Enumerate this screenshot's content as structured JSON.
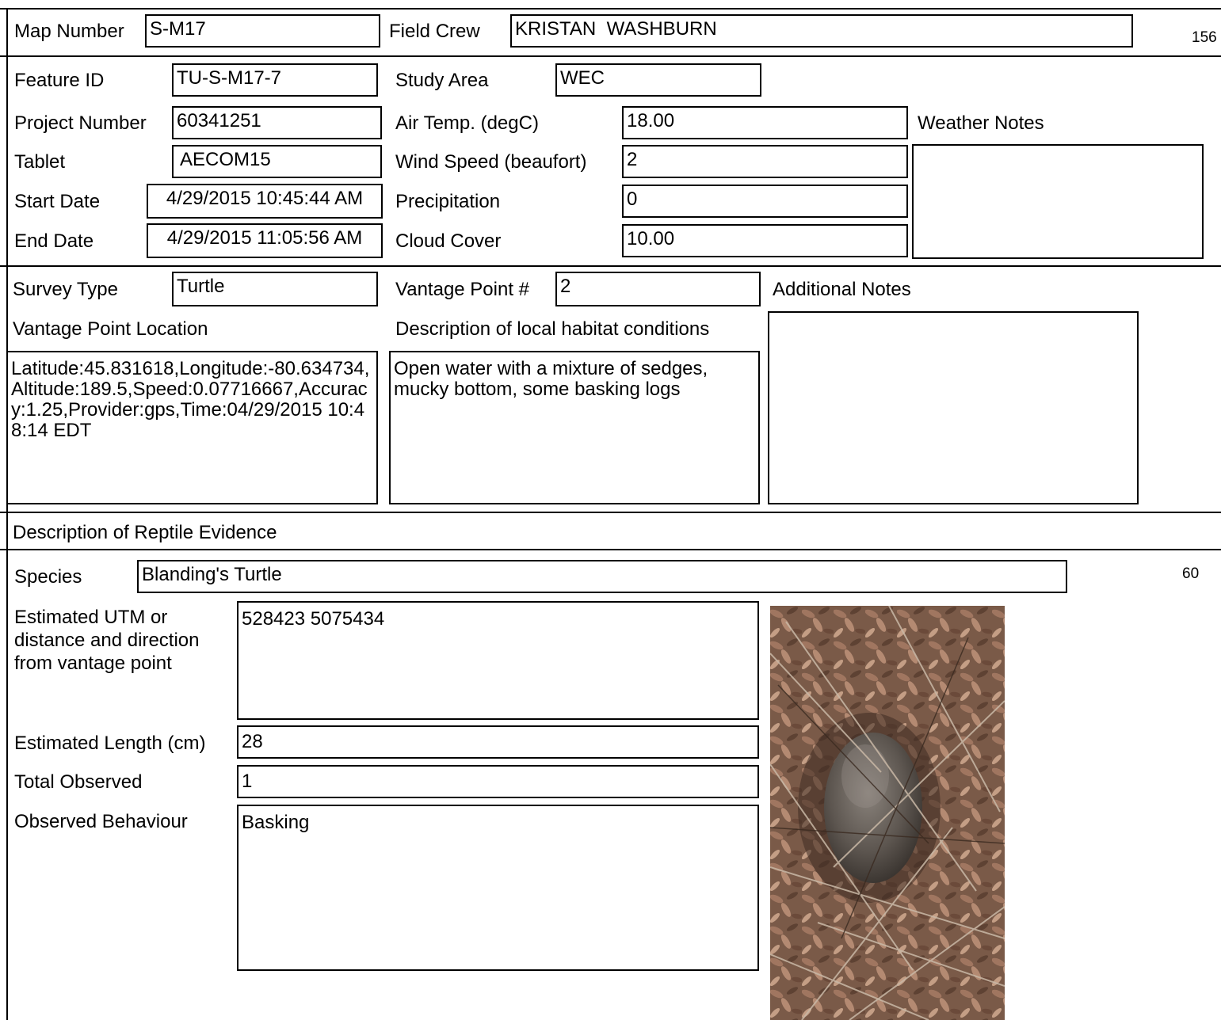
{
  "header": {
    "map_number_label": "Map Number",
    "map_number_value": "S-M17",
    "field_crew_label": "Field Crew",
    "field_crew_value": "KRISTAN  WASHBURN",
    "page_number": "156"
  },
  "details": {
    "feature_id_label": "Feature ID",
    "feature_id_value": "TU-S-M17-7",
    "study_area_label": "Study Area",
    "study_area_value": "WEC",
    "project_number_label": "Project Number",
    "project_number_value": "60341251",
    "air_temp_label": "Air Temp. (degC)",
    "air_temp_value": "18.00",
    "weather_notes_label": "Weather Notes",
    "weather_notes_value": "",
    "tablet_label": "Tablet",
    "tablet_value": "AECOM15",
    "wind_speed_label": "Wind Speed (beaufort)",
    "wind_speed_value": "2",
    "start_date_label": "Start Date",
    "start_date_value": "4/29/2015 10:45:44 AM",
    "precipitation_label": "Precipitation",
    "precipitation_value": "0",
    "end_date_label": "End Date",
    "end_date_value": "4/29/2015 11:05:56 AM",
    "cloud_cover_label": "Cloud Cover",
    "cloud_cover_value": "10.00"
  },
  "survey": {
    "survey_type_label": "Survey Type",
    "survey_type_value": "Turtle",
    "vantage_point_label": "Vantage Point #",
    "vantage_point_value": "2",
    "additional_notes_label": "Additional Notes",
    "additional_notes_value": "",
    "vantage_location_label": "Vantage Point Location",
    "vantage_location_value": "Latitude:45.831618,Longitude:-80.634734,Altitude:189.5,Speed:0.07716667,Accuracy:1.25,Provider:gps,Time:04/29/2015 10:48:14 EDT",
    "habitat_label": "Description of local habitat conditions",
    "habitat_value": "Open water with a mixture of sedges, mucky bottom, some basking logs"
  },
  "evidence": {
    "section_label": "Description of Reptile Evidence",
    "species_label": "Species",
    "species_value": "Blanding's Turtle",
    "side_number": "60",
    "utm_label": "Estimated UTM or distance and direction from vantage point",
    "utm_value": "528423 5075434",
    "length_label": "Estimated Length (cm)",
    "length_value": "28",
    "total_label": "Total Observed",
    "total_value": "1",
    "behaviour_label": "Observed Behaviour",
    "behaviour_value": "Basking"
  },
  "colors": {
    "line": "#000000",
    "background": "#ffffff",
    "leaf_litter": "#8a6450",
    "turtle_shell": "#5d5650"
  },
  "icons": {
    "photo": "turtle-photo"
  }
}
